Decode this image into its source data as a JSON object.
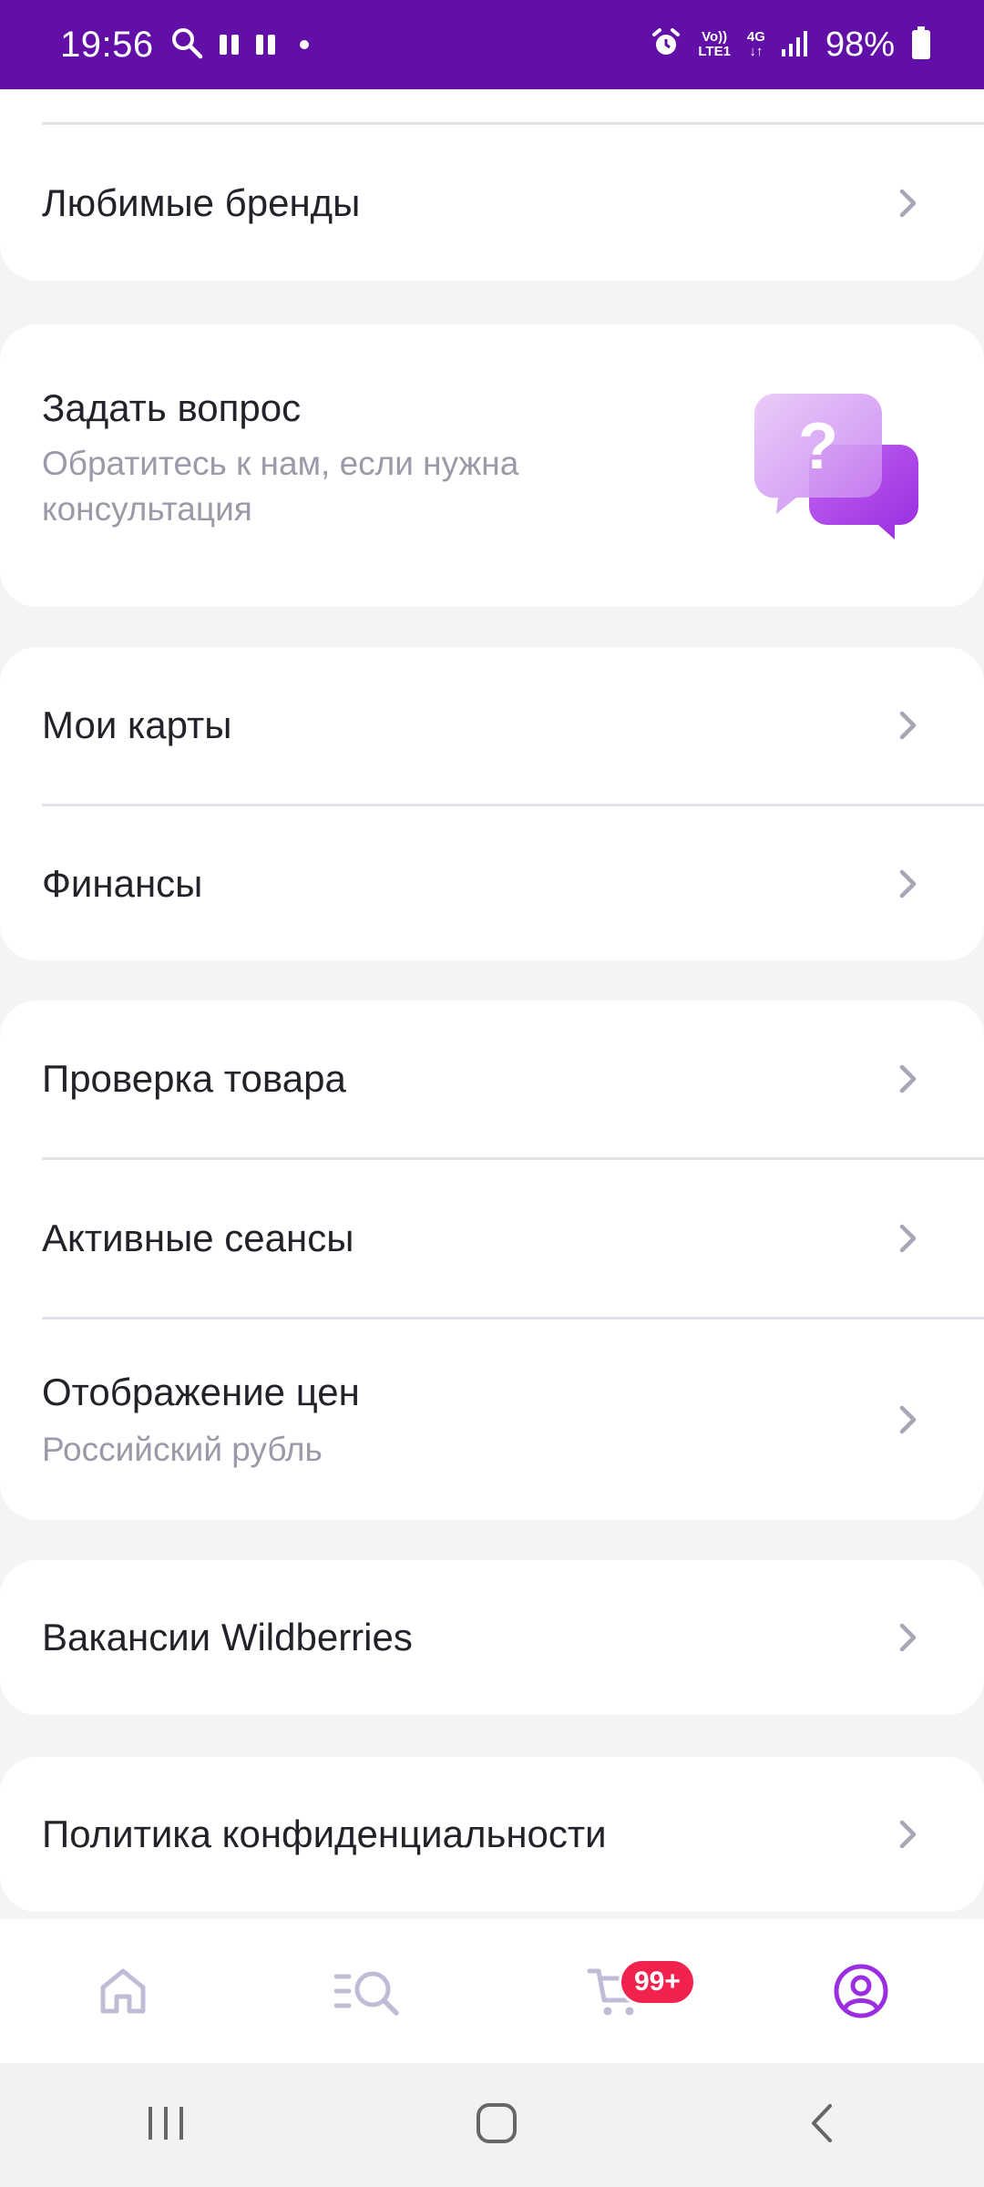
{
  "status_bar": {
    "time": "19:56",
    "network_top": "Vo))",
    "network_bottom": "LTE1",
    "net_4g": "4G",
    "battery": "98%"
  },
  "menu": {
    "favorite_brands": "Любимые бренды",
    "ask_question": {
      "title": "Задать вопрос",
      "subtitle_line1": "Обратитесь к нам, если нужна",
      "subtitle_line2": "консультация"
    },
    "my_cards": "Мои карты",
    "finances": "Финансы",
    "product_check": "Проверка товара",
    "active_sessions": "Активные сеансы",
    "price_display": {
      "title": "Отображение цен",
      "value": "Российский рубль"
    },
    "vacancies": "Вакансии Wildberries",
    "privacy_policy": "Политика конфиденциальности"
  },
  "bottom_nav": {
    "items": [
      "home-icon",
      "catalog-search-icon",
      "cart-icon",
      "profile-icon"
    ],
    "cart_badge": "99+",
    "active": "profile"
  },
  "colors": {
    "brand": "#610fa7",
    "accent": "#a12de4",
    "badge": "#f2224e"
  }
}
